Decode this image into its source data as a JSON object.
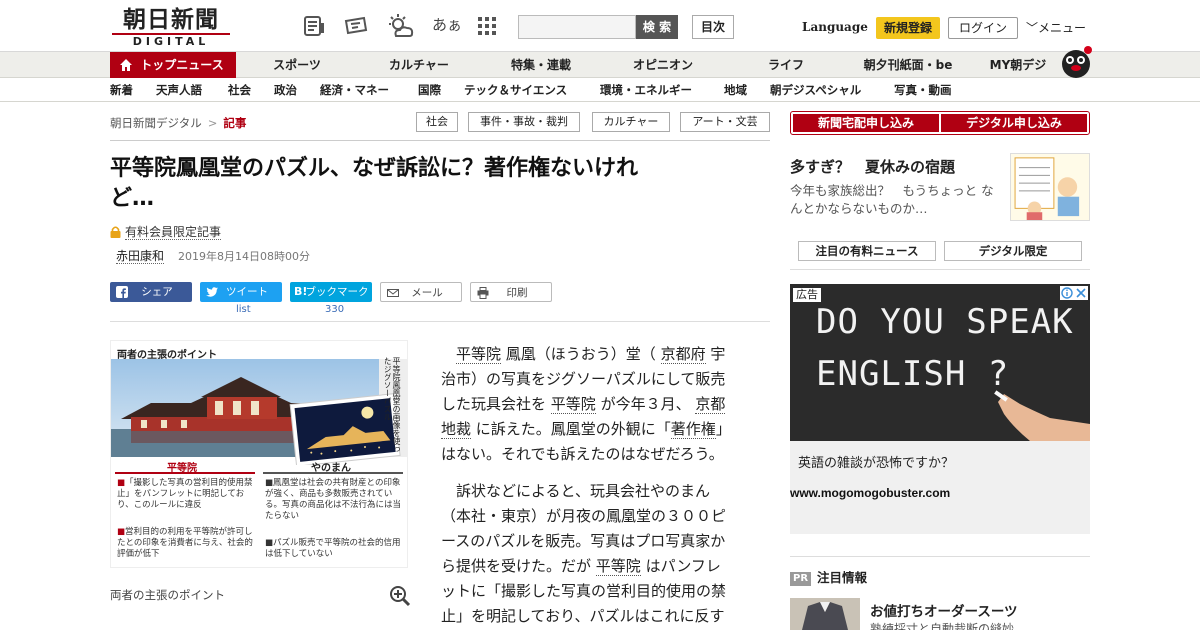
{
  "header": {
    "logo_jp": "朝日新聞",
    "logo_en": "DIGITAL",
    "search_button": "検 索",
    "toc_button": "目次",
    "language": "Language",
    "signup": "新規登録",
    "login": "ログイン",
    "menu": "メニュー",
    "kana_icon": "あぁ"
  },
  "nav_main": {
    "items": [
      "トップニュース",
      "スポーツ",
      "カルチャー",
      "特集・連載",
      "オピニオン",
      "ライフ",
      "朝夕刊紙面・be",
      "MY朝デジ"
    ]
  },
  "nav_sub": {
    "items": [
      "新着",
      "天声人語",
      "社会",
      "政治",
      "経済・マネー",
      "国際",
      "テック＆サイエンス",
      "環境・エネルギー",
      "地域",
      "朝デジスペシャル",
      "写真・動画"
    ]
  },
  "breadcrumb": {
    "home": "朝日新聞デジタル",
    "sep": ">",
    "current": "記事"
  },
  "tags": [
    "社会",
    "事件・事故・裁判",
    "カルチャー",
    "アート・文芸"
  ],
  "article": {
    "headline_line1": "平等院鳳凰堂のパズル、なぜ訴訟に？著作権ないけれ",
    "headline_line2": "ど…",
    "members_only": "有料会員限定記事",
    "author": "赤田康和",
    "date": "2019年8月14日08時00分",
    "share": {
      "facebook": "シェア",
      "twitter": "ツイート",
      "hatena": "ブックマーク",
      "mail": "メール",
      "print": "印刷",
      "twitter_count": "list",
      "hatena_count": "330"
    },
    "figure": {
      "title": "両者の主張のポイント",
      "side_text": "平等院鳳凰堂の画像を使ったジグソーパズル",
      "left_label": "平等院",
      "right_label": "やのまん",
      "left_note1": "「撮影した写真の営利目的使用禁止」をパンフレットに明記しており、このルールに違反",
      "left_note2": "営利目的の利用を平等院が許可したとの印象を消費者に与え、社会的評価が低下",
      "right_note1": "鳳凰堂は社会の共有財産との印象が強く、商品も多数販売されている。写真の商品化は不法行為には当たらない",
      "right_note2": "パズル販売で平等院の社会的信用は低下していない"
    },
    "caption": "両者の主張のポイント",
    "para1": {
      "l1a": "平等院",
      "l1b": " 鳳凰（ほうおう）堂（ ",
      "l1c": "京都府",
      "l1d": " 宇",
      "l2": "治市）の写真をジグソーパズルにして販売",
      "l3a": "した玩具会社を ",
      "l3b": "平等院",
      "l3c": " が今年３月、 ",
      "l3d": "京都",
      "l4a": "地裁",
      "l4b": " に訴えた。鳳凰堂の外観に「",
      "l4c": "著作権",
      "l4d": "」",
      "l5": "はない。それでも訴えたのはなぜだろう。"
    },
    "para2": {
      "l1": "訴状などによると、玩具会社やのまん",
      "l2": "（本社・東京）が月夜の鳳凰堂の３００ピ",
      "l3": "ースのパズルを販売。写真はプロ写真家か",
      "l4a": "ら提供を受けた。だが ",
      "l4b": "平等院",
      "l4c": " はパンフレ",
      "l5": "ットに「撮影した写真の営利目的使用の禁",
      "l6": "止」を明記しており、パズルはこれに反す"
    }
  },
  "sidebar": {
    "subscribe_paper": "新聞宅配申し込み",
    "subscribe_digital": "デジタル申し込み",
    "promo_title": "多すぎ？　夏休みの宿題",
    "promo_text": "今年も家族総出？　もうちょっと なんとかならないものか…",
    "tab_paid": "注目の有料ニュース",
    "tab_digital": "デジタル限定",
    "ad": {
      "badge": "広告",
      "chalk_line1": "DO YOU SPEAK",
      "chalk_line2": "ENGLISH ?",
      "title": "英語の雑談が恐怖ですか？",
      "url": "www.mogomogobuster.com"
    },
    "pr": {
      "badge": "PR",
      "heading": "注目情報",
      "item_title": "お値打ちオーダースーツ",
      "item_sub": "熟練採寸と自動裁断の縫妙"
    }
  },
  "colors": {
    "brand_red": "#b00012",
    "signup_yellow": "#f3c61d",
    "facebook": "#3b5998",
    "twitter": "#1da1f2",
    "hatena": "#00a4de"
  },
  "icons": [
    "newspaper-icon",
    "sign-icon",
    "weather-icon",
    "kana-icon",
    "grid-icon",
    "search-icon",
    "lock-icon",
    "zoom-icon",
    "mascot-icon"
  ]
}
